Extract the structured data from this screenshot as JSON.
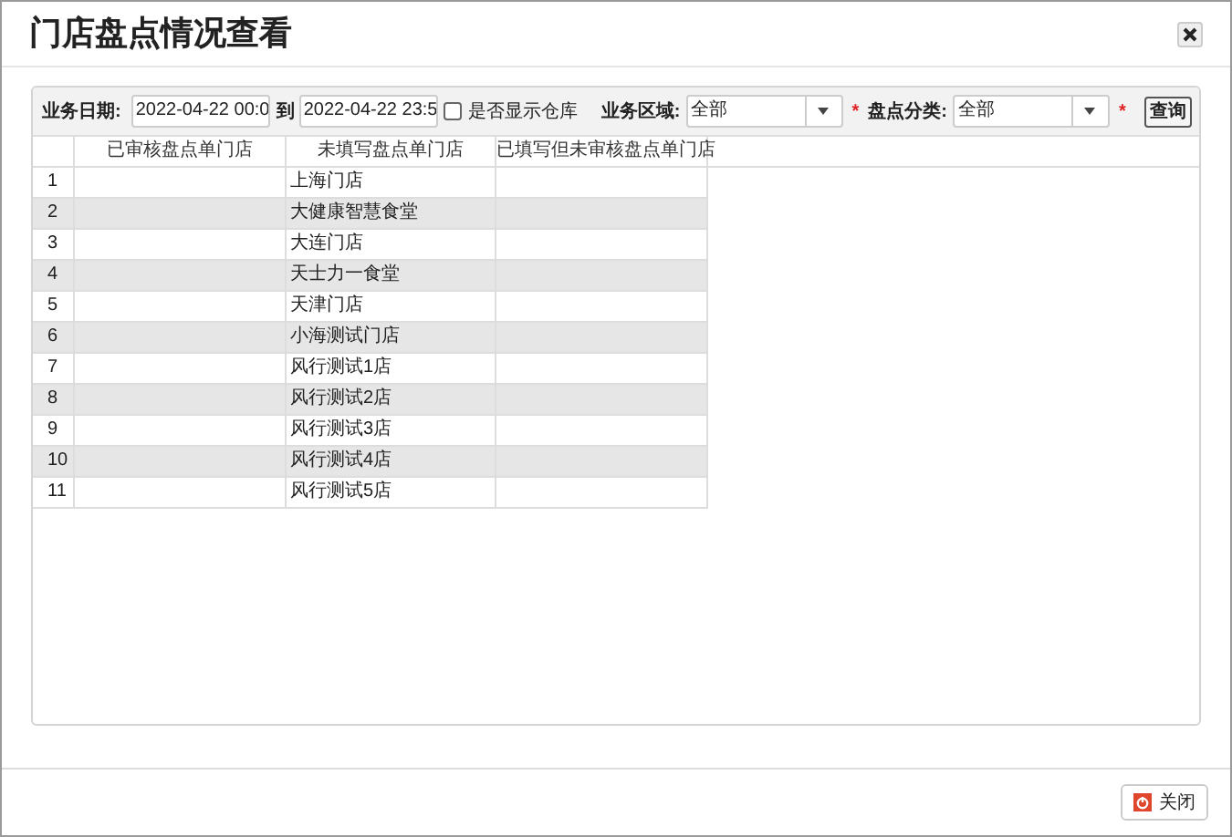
{
  "window": {
    "title": "门店盘点情况查看"
  },
  "filters": {
    "date_label": "业务日期:",
    "date_from": "2022-04-22 00:0",
    "date_to_label": "到",
    "date_to": "2022-04-22 23:5",
    "show_warehouse": {
      "label": "是否显示仓库",
      "checked": false
    },
    "region_label": "业务区域:",
    "region_value": "全部",
    "required_mark_1": "*",
    "category_label": "盘点分类:",
    "category_value": "全部",
    "required_mark_2": "*",
    "query_button": "查询"
  },
  "table": {
    "columns": [
      "已审核盘点单门店",
      "未填写盘点单门店",
      "已填写但未审核盘点单门店"
    ],
    "rows": [
      {
        "index": "1",
        "cells": [
          "",
          "上海门店",
          ""
        ]
      },
      {
        "index": "2",
        "cells": [
          "",
          "大健康智慧食堂",
          ""
        ]
      },
      {
        "index": "3",
        "cells": [
          "",
          "大连门店",
          ""
        ]
      },
      {
        "index": "4",
        "cells": [
          "",
          "天士力一食堂",
          ""
        ]
      },
      {
        "index": "5",
        "cells": [
          "",
          "天津门店",
          ""
        ]
      },
      {
        "index": "6",
        "cells": [
          "",
          "小海测试门店",
          ""
        ]
      },
      {
        "index": "7",
        "cells": [
          "",
          "风行测试1店",
          ""
        ]
      },
      {
        "index": "8",
        "cells": [
          "",
          "风行测试2店",
          ""
        ]
      },
      {
        "index": "9",
        "cells": [
          "",
          "风行测试3店",
          ""
        ]
      },
      {
        "index": "10",
        "cells": [
          "",
          "风行测试4店",
          ""
        ]
      },
      {
        "index": "11",
        "cells": [
          "",
          "风行测试5店",
          ""
        ]
      }
    ]
  },
  "footer": {
    "close_button": "关闭"
  }
}
